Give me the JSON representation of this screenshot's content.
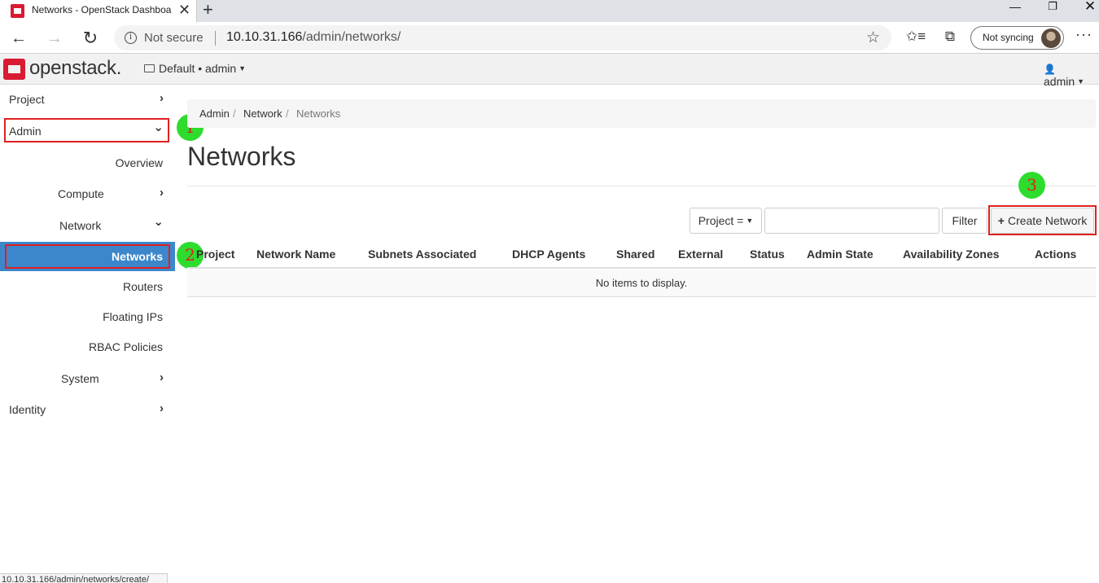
{
  "browser": {
    "tab_title": "Networks - OpenStack Dashboard",
    "tab_close": "✕",
    "new_tab": "+",
    "window_min": "—",
    "window_max": "❐",
    "window_close": "✕",
    "back": "←",
    "forward": "→",
    "reload": "↻",
    "info": "i",
    "security_label": "Not secure",
    "url_host": "10.10.31.166",
    "url_path": "/admin/networks/",
    "star": "☆",
    "favorites": "✩≡",
    "collections": "⧉",
    "sync_label": "Not syncing",
    "more": "···",
    "status_url": "10.10.31.166/admin/networks/create/"
  },
  "header": {
    "logo_text": "openstack.",
    "domain_project": "Default • admin",
    "caret": "▼",
    "user_icon": "👤",
    "user": "admin"
  },
  "sidebar": {
    "chevron_right": "›",
    "chevron_down": "⌄",
    "items": [
      {
        "label": "Project"
      },
      {
        "label": "Admin"
      },
      {
        "label": "Overview"
      },
      {
        "label": "Compute"
      },
      {
        "label": "Network"
      },
      {
        "label": "Networks"
      },
      {
        "label": "Routers"
      },
      {
        "label": "Floating IPs"
      },
      {
        "label": "RBAC Policies"
      },
      {
        "label": "System"
      },
      {
        "label": "Identity"
      }
    ]
  },
  "annotations": {
    "markers": [
      "1",
      "2",
      "3"
    ],
    "highlight_color": "#e02020",
    "marker_color": "#2ddc2d"
  },
  "main": {
    "breadcrumb": [
      "Admin",
      "Network",
      "Networks"
    ],
    "breadcrumb_sep": "/",
    "title": "Networks",
    "filter_field": "Project =",
    "filter_value": "",
    "filter_button": "Filter",
    "create_plus": "+",
    "create_button": "Create Network",
    "columns": [
      "Project",
      "Network Name",
      "Subnets Associated",
      "DHCP Agents",
      "Shared",
      "External",
      "Status",
      "Admin State",
      "Availability Zones",
      "Actions"
    ],
    "empty_message": "No items to display."
  },
  "colors": {
    "accent": "#3c87cc",
    "brand": "#da1a32"
  }
}
